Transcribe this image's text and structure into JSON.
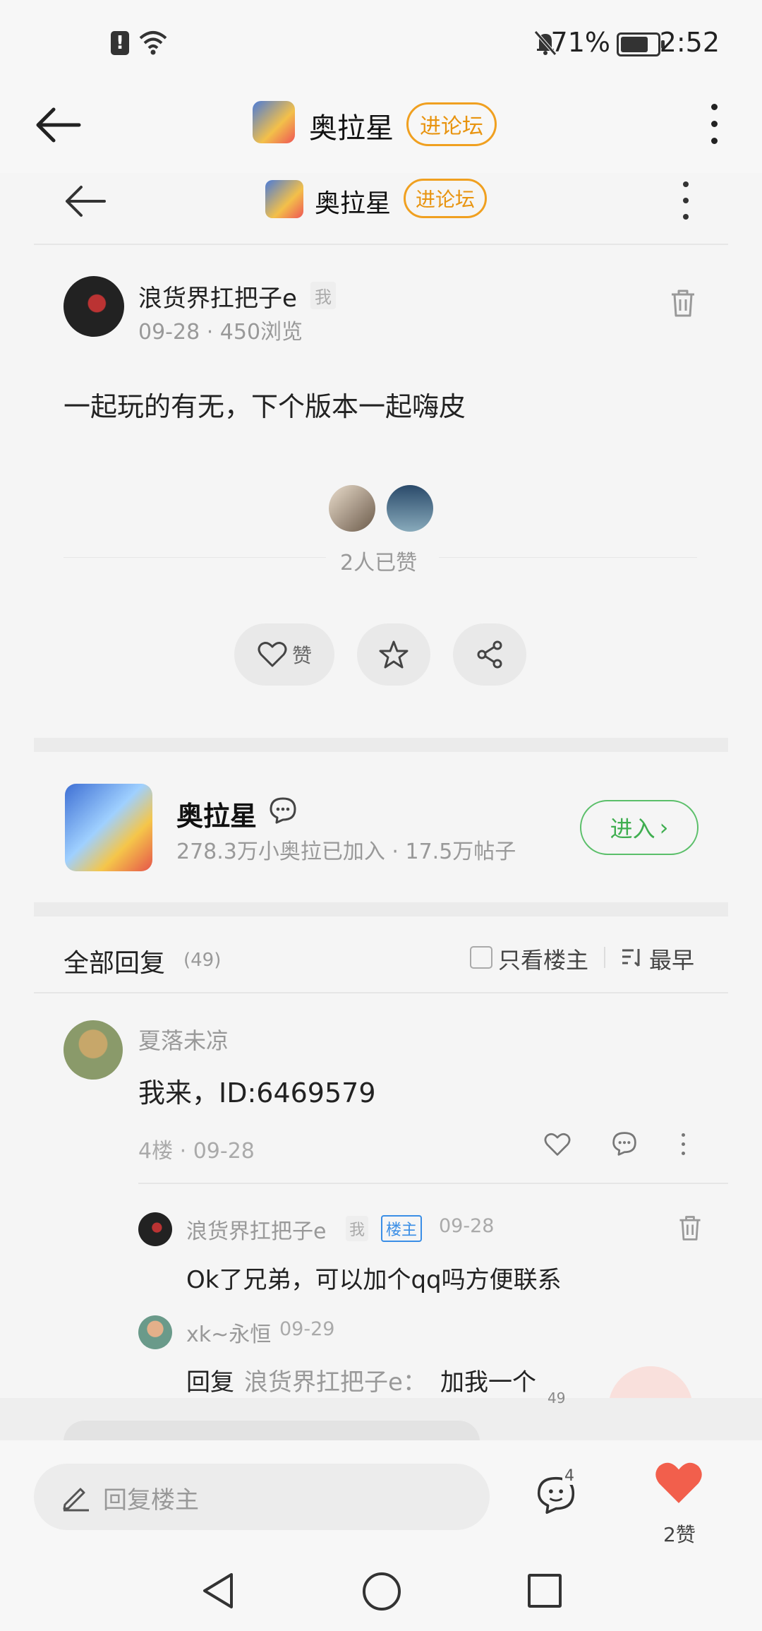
{
  "status_bar": {
    "battery_pct": "71%",
    "time": "2:52"
  },
  "header": {
    "title": "奥拉星",
    "enter_forum": "进论坛"
  },
  "post": {
    "author": "浪货界扛把子e",
    "me_tag": "我",
    "meta": "09-28 · 450浏览",
    "text": "一起玩的有无，下个版本一起嗨皮",
    "likes_text": "2人已赞",
    "like_label": "赞"
  },
  "forum_card": {
    "name": "奥拉星",
    "stats": "278.3万小奥拉已加入 · 17.5万帖子",
    "enter": "进入"
  },
  "replies": {
    "title": "全部回复",
    "count": "(49)",
    "only_owner": "只看楼主",
    "sort": "最早",
    "items": [
      {
        "user": "夏落未凉",
        "text": "我来，ID:6469579",
        "meta": "4楼 · 09-28",
        "subreplies": [
          {
            "user": "浪货界扛把子e",
            "me_tag": "我",
            "owner_tag": "楼主",
            "date": "09-28",
            "text": "Ok了兄弟，可以加个qq吗方便联系"
          },
          {
            "user": "xk~永恒",
            "date": "09-29",
            "reply_prefix": "回复",
            "reply_to": "浪货界扛把子e：",
            "text": "加我一个"
          }
        ]
      }
    ]
  },
  "bottom_bar": {
    "reply_placeholder": "回复楼主",
    "comment_badge": "4",
    "comment_badge_behind": "49",
    "like_count": "2赞"
  }
}
